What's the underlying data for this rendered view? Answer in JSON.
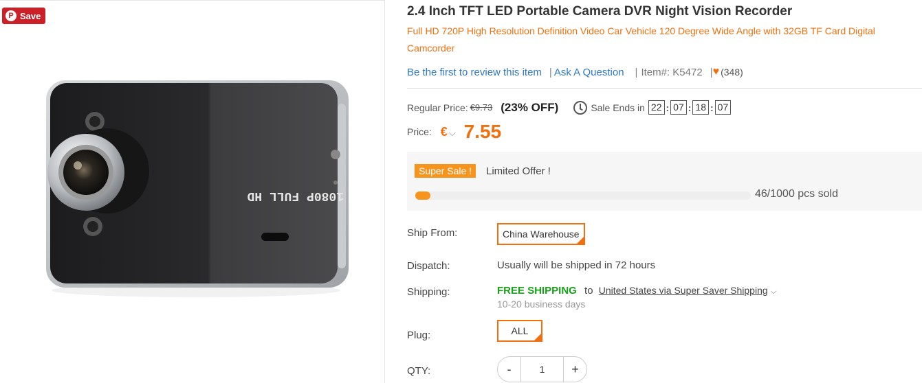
{
  "pinterest": {
    "save_label": "Save",
    "icon": "pinterest-icon"
  },
  "product": {
    "title": "2.4 Inch TFT LED Portable Camera DVR Night Vision Recorder",
    "subtitle": "Full HD 720P High Resolution Definition Video Car Vehicle 120 Degree Wide Angle with 32GB TF Card Digital Camcorder",
    "device_text": "1080P FULL HD"
  },
  "meta": {
    "review_link": "Be the first to review this item",
    "question_link": "Ask A Question",
    "item_no": "Item#: K5472",
    "wishlist_count": "(348)"
  },
  "pricing": {
    "regular_label": "Regular Price:",
    "regular_price": "€9.73",
    "discount": "(23% OFF)",
    "sale_ends_label": "Sale Ends in",
    "timer": [
      "22",
      "07",
      "18",
      "07"
    ],
    "price_label": "Price:",
    "currency": "€",
    "price": "7.55"
  },
  "sale": {
    "tag": "Super Sale !",
    "limited": "Limited Offer  !",
    "sold_text": "46/1000 pcs sold",
    "sold_fraction": 0.046
  },
  "options": {
    "ship_from_label": "Ship From:",
    "ship_from_value": "China Warehouse",
    "dispatch_label": "Dispatch:",
    "dispatch_value": "Usually will be shipped in 72 hours",
    "shipping_label": "Shipping:",
    "shipping_free": "FREE SHIPPING",
    "shipping_to": "to",
    "shipping_method": "United States via Super Saver Shipping",
    "shipping_days": "10-20 business days",
    "plug_label": "Plug:",
    "plug_value": "ALL",
    "qty_label": "QTY:",
    "qty_value": "1",
    "qty_minus": "-",
    "qty_plus": "+"
  },
  "colors": {
    "accent": "#f07010",
    "link": "#2f78c4",
    "free": "#19a01b",
    "pinterest": "#cb2027"
  }
}
